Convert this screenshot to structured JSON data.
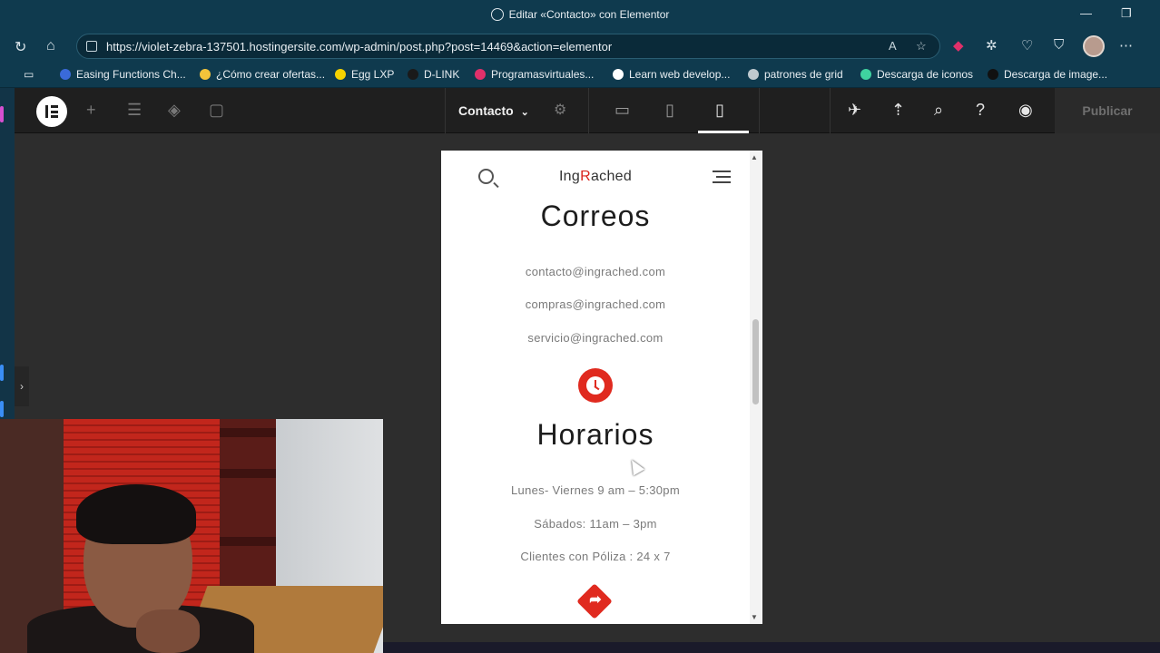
{
  "browser": {
    "window_title": "Editar «Contacto» con Elementor",
    "url": "https://violet-zebra-137501.hostingersite.com/wp-admin/post.php?post=14469&action=elementor",
    "bookmarks": [
      {
        "label": "Easing Functions Ch...",
        "color": "#3a6ad9"
      },
      {
        "label": "¿Cómo crear ofertas...",
        "color": "#f3c43a"
      },
      {
        "label": "Egg LXP",
        "color": "#f6d200"
      },
      {
        "label": "D-LINK",
        "color": "#1a1a1a"
      },
      {
        "label": "Programasvirtuales...",
        "color": "#e0306a"
      },
      {
        "label": "Learn web develop...",
        "color": "#ffffff"
      },
      {
        "label": "patrones de grid",
        "color": "#bfc9cf"
      },
      {
        "label": "Descarga de iconos",
        "color": "#3fd3a0"
      },
      {
        "label": "Descarga de image...",
        "color": "#111111"
      }
    ]
  },
  "editor": {
    "document_title": "Contacto",
    "publish_label": "Publicar"
  },
  "preview": {
    "brand_prefix": "Ing",
    "brand_r": "R",
    "brand_suffix": "ached",
    "emails_title": "Correos",
    "emails": [
      "contacto@ingrached.com",
      "compras@ingrached.com",
      "servicio@ingrached.com"
    ],
    "hours_title": "Horarios",
    "hours": [
      "Lunes- Viernes 9 am – 5:30pm",
      "Sábados: 11am – 3pm",
      "Clientes con Póliza : 24 x 7"
    ]
  },
  "colors": {
    "accent_red": "#e02a1f",
    "browser_chrome": "#0f3a4e",
    "editor_bar": "#1f1f1f"
  }
}
